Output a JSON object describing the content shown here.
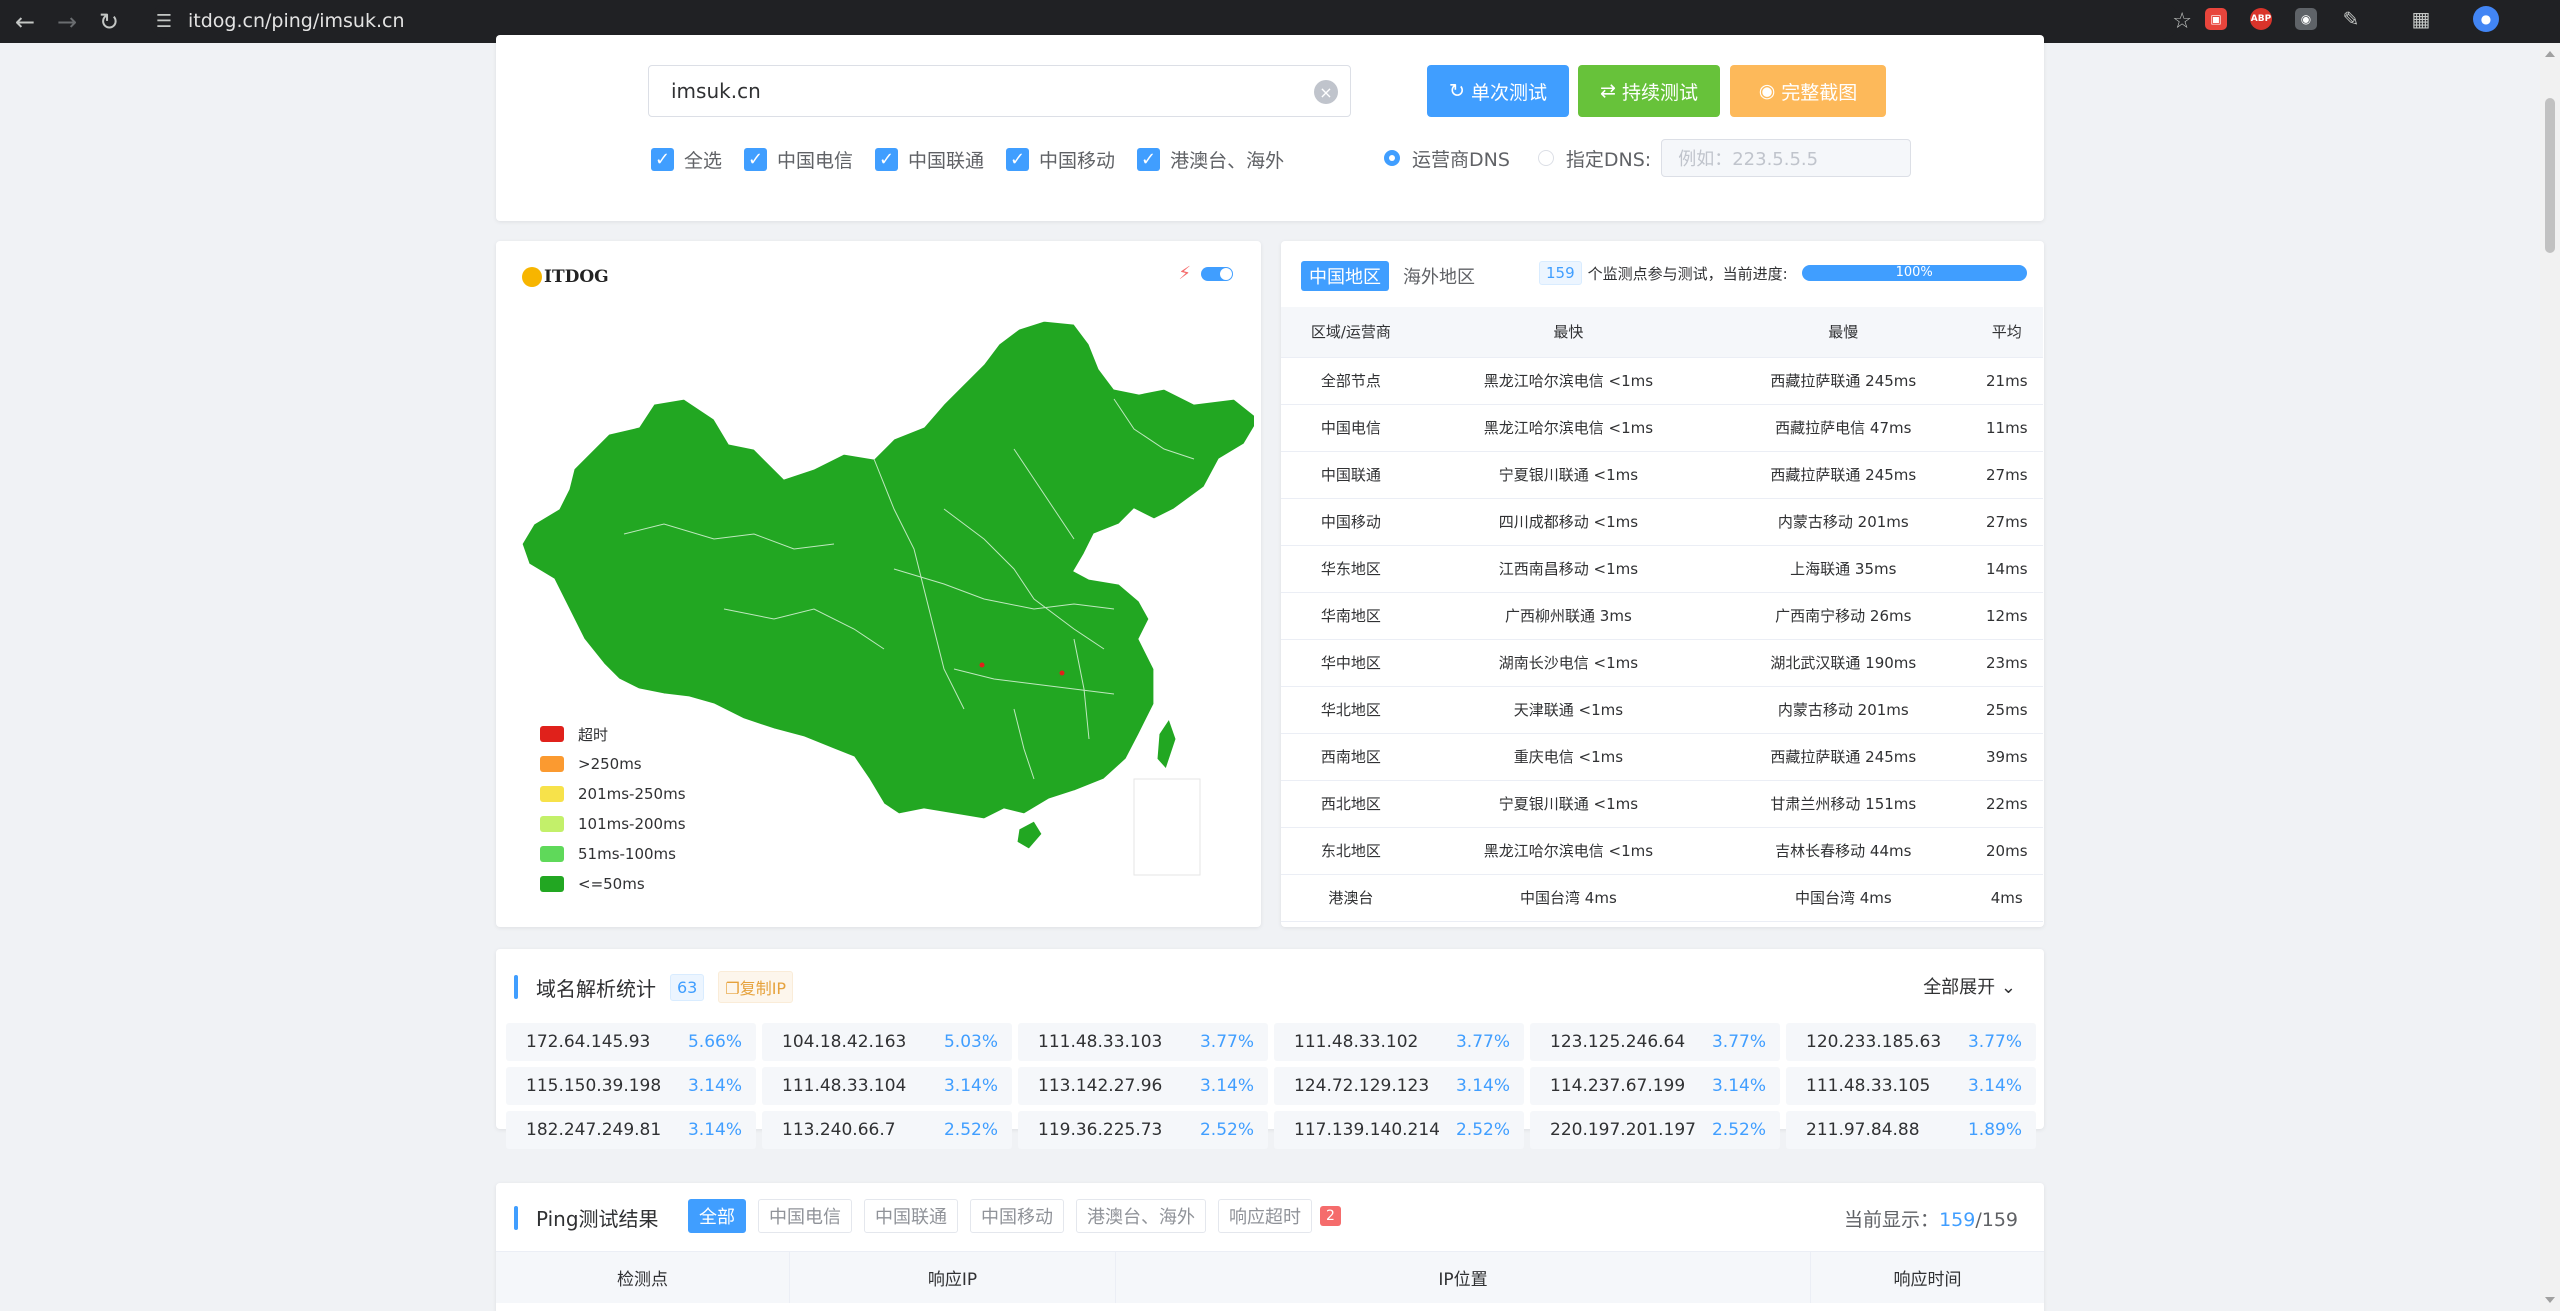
{
  "browser": {
    "url": "itdog.cn/ping/imsuk.cn",
    "ext_labels": [
      "ABP"
    ]
  },
  "search": {
    "value": "imsuk.cn",
    "btn_single": "单次测试",
    "btn_continuous": "持续测试",
    "btn_screenshot": "完整截图",
    "colors": {
      "single": "#409eff",
      "continuous": "#67c23a",
      "screenshot": "#fdb95a"
    }
  },
  "filters": {
    "checks": [
      "全选",
      "中国电信",
      "中国联通",
      "中国移动",
      "港澳台、海外"
    ],
    "dns_isp": "运营商DNS",
    "dns_custom": "指定DNS:",
    "dns_placeholder": "例如：223.5.5.5"
  },
  "map": {
    "logo": "ITDOG",
    "legend": [
      {
        "label": "超时",
        "color": "#e0211b"
      },
      {
        "label": ">250ms",
        "color": "#fb9a30"
      },
      {
        "label": "201ms-250ms",
        "color": "#f7e24a"
      },
      {
        "label": "101ms-200ms",
        "color": "#c3f06a"
      },
      {
        "label": "51ms-100ms",
        "color": "#5fd95a"
      },
      {
        "label": "<=50ms",
        "color": "#22a722"
      }
    ]
  },
  "region_table": {
    "tab_china": "中国地区",
    "tab_overseas": "海外地区",
    "node_count": "159",
    "progress_text": "个监测点参与测试，当前进度:",
    "progress": "100%",
    "headers": [
      "区域/运营商",
      "最快",
      "最慢",
      "平均"
    ],
    "rows": [
      [
        "全部节点",
        "黑龙江哈尔滨电信 <1ms",
        "西藏拉萨联通 245ms",
        "21ms"
      ],
      [
        "中国电信",
        "黑龙江哈尔滨电信 <1ms",
        "西藏拉萨电信 47ms",
        "11ms"
      ],
      [
        "中国联通",
        "宁夏银川联通 <1ms",
        "西藏拉萨联通 245ms",
        "27ms"
      ],
      [
        "中国移动",
        "四川成都移动 <1ms",
        "内蒙古移动 201ms",
        "27ms"
      ],
      [
        "华东地区",
        "江西南昌移动 <1ms",
        "上海联通 35ms",
        "14ms"
      ],
      [
        "华南地区",
        "广西柳州联通 3ms",
        "广西南宁移动 26ms",
        "12ms"
      ],
      [
        "华中地区",
        "湖南长沙电信 <1ms",
        "湖北武汉联通 190ms",
        "23ms"
      ],
      [
        "华北地区",
        "天津联通 <1ms",
        "内蒙古移动 201ms",
        "25ms"
      ],
      [
        "西南地区",
        "重庆电信 <1ms",
        "西藏拉萨联通 245ms",
        "39ms"
      ],
      [
        "西北地区",
        "宁夏银川联通 <1ms",
        "甘肃兰州移动 151ms",
        "22ms"
      ],
      [
        "东北地区",
        "黑龙江哈尔滨电信 <1ms",
        "吉林长春移动 44ms",
        "20ms"
      ],
      [
        "港澳台",
        "中国台湾 4ms",
        "中国台湾 4ms",
        "4ms"
      ]
    ]
  },
  "dns_stats": {
    "title": "域名解析统计",
    "count": "63",
    "copy_ip": "复制IP",
    "expand_all": "全部展开",
    "items": [
      {
        "ip": "172.64.145.93",
        "pct": "5.66%"
      },
      {
        "ip": "104.18.42.163",
        "pct": "5.03%"
      },
      {
        "ip": "111.48.33.103",
        "pct": "3.77%"
      },
      {
        "ip": "111.48.33.102",
        "pct": "3.77%"
      },
      {
        "ip": "123.125.246.64",
        "pct": "3.77%"
      },
      {
        "ip": "120.233.185.63",
        "pct": "3.77%"
      },
      {
        "ip": "115.150.39.198",
        "pct": "3.14%"
      },
      {
        "ip": "111.48.33.104",
        "pct": "3.14%"
      },
      {
        "ip": "113.142.27.96",
        "pct": "3.14%"
      },
      {
        "ip": "124.72.129.123",
        "pct": "3.14%"
      },
      {
        "ip": "114.237.67.199",
        "pct": "3.14%"
      },
      {
        "ip": "111.48.33.105",
        "pct": "3.14%"
      },
      {
        "ip": "182.247.249.81",
        "pct": "3.14%"
      },
      {
        "ip": "113.240.66.7",
        "pct": "2.52%"
      },
      {
        "ip": "119.36.225.73",
        "pct": "2.52%"
      },
      {
        "ip": "117.139.140.214",
        "pct": "2.52%"
      },
      {
        "ip": "220.197.201.197",
        "pct": "2.52%"
      },
      {
        "ip": "211.97.84.88",
        "pct": "1.89%"
      }
    ]
  },
  "ping_results": {
    "title": "Ping测试结果",
    "tabs": [
      "全部",
      "中国电信",
      "中国联通",
      "中国移动",
      "港澳台、海外",
      "响应超时"
    ],
    "timeout_count": "2",
    "current_label": "当前显示：",
    "current_shown": "159",
    "current_total": "/159",
    "headers": [
      "检测点",
      "响应IP",
      "IP位置",
      "响应时间"
    ]
  }
}
